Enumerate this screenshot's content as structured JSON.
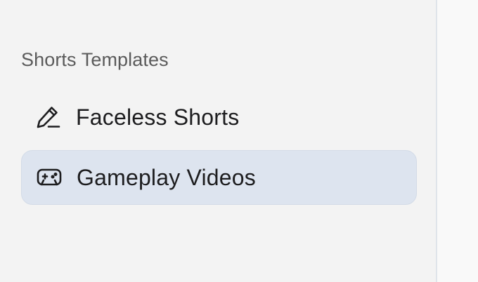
{
  "sidebar": {
    "section_label": "Shorts Templates",
    "items": [
      {
        "label": "Faceless Shorts",
        "icon": "pencil-icon",
        "active": false
      },
      {
        "label": "Gameplay Videos",
        "icon": "gamepad-icon",
        "active": true
      }
    ]
  },
  "colors": {
    "sidebar_bg": "#f3f3f3",
    "active_bg": "#dde4ef",
    "text": "#1d1d1f",
    "section_label": "#5b5b5b"
  }
}
